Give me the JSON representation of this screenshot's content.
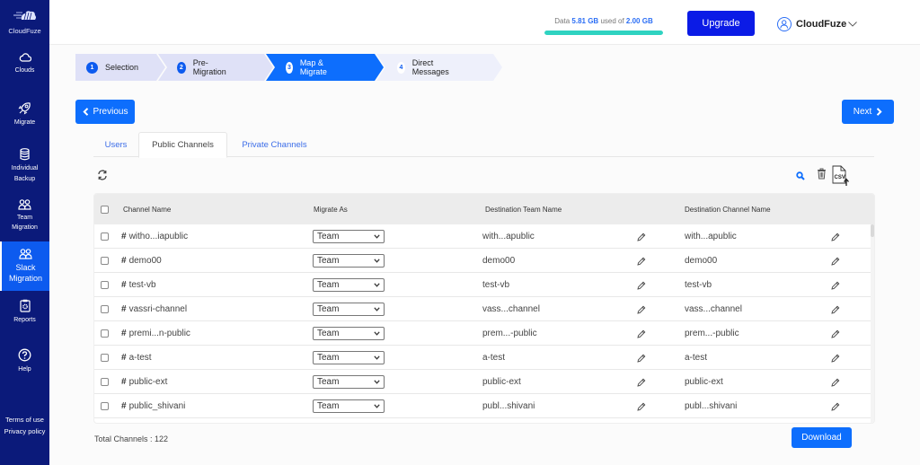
{
  "app": {
    "brand": "CloudFuze",
    "accent": "#0d6efd",
    "sidebar_bg": "#0b1a7a"
  },
  "sidebar": {
    "items": [
      {
        "label": "Clouds",
        "icon": "cloud-icon"
      },
      {
        "label": "Migrate",
        "icon": "rocket-icon"
      },
      {
        "label": "Individual Backup",
        "line1": "Individual",
        "line2": "Backup",
        "icon": "database-icon"
      },
      {
        "label": "Team Migration",
        "line1": "Team",
        "line2": "Migration",
        "icon": "users-icon"
      },
      {
        "label": "Slack Migration",
        "line1": "Slack",
        "line2": "Migration",
        "icon": "users-icon",
        "active": true
      },
      {
        "label": "Reports",
        "icon": "clipboard-gear-icon"
      },
      {
        "label": "Help",
        "icon": "help-circle-icon"
      }
    ],
    "footer": {
      "terms": "Terms of use",
      "privacy": "Privacy policy"
    }
  },
  "header": {
    "usage": {
      "prefix": "Data",
      "used": "5.81 GB",
      "middle": "used of",
      "total": "2.00 GB",
      "fill_percent": 100
    },
    "upgrade_label": "Upgrade",
    "user_name": "CloudFuze"
  },
  "stepper": {
    "steps": [
      {
        "num": "1",
        "label": "Selection",
        "state": "done"
      },
      {
        "num": "2",
        "label": "Pre-Migration",
        "state": "done"
      },
      {
        "num": "3",
        "label": "Map & Migrate",
        "state": "active"
      },
      {
        "num": "4",
        "label": "Direct Messages",
        "state": "future"
      }
    ]
  },
  "nav": {
    "previous_label": "Previous",
    "next_label": "Next"
  },
  "tabs": [
    {
      "label": "Users"
    },
    {
      "label": "Public Channels",
      "active": true
    },
    {
      "label": "Private Channels"
    }
  ],
  "table": {
    "columns": [
      "Channel Name",
      "Migrate As",
      "Destination Team Name",
      "Destination Channel Name"
    ],
    "rows": [
      {
        "channel": "witho...iapublic",
        "migrate_as": "Team",
        "dest_team": "with...apublic",
        "dest_channel": "with...apublic"
      },
      {
        "channel": "demo00",
        "migrate_as": "Team",
        "dest_team": "demo00",
        "dest_channel": "demo00"
      },
      {
        "channel": "test-vb",
        "migrate_as": "Team",
        "dest_team": "test-vb",
        "dest_channel": "test-vb"
      },
      {
        "channel": "vassri-channel",
        "migrate_as": "Team",
        "dest_team": "vass...channel",
        "dest_channel": "vass...channel"
      },
      {
        "channel": "premi...n-public",
        "migrate_as": "Team",
        "dest_team": "prem...-public",
        "dest_channel": "prem...-public"
      },
      {
        "channel": "a-test",
        "migrate_as": "Team",
        "dest_team": "a-test",
        "dest_channel": "a-test"
      },
      {
        "channel": "public-ext",
        "migrate_as": "Team",
        "dest_team": "public-ext",
        "dest_channel": "public-ext"
      },
      {
        "channel": "public_shivani",
        "migrate_as": "Team",
        "dest_team": "publ...shivani",
        "dest_channel": "publ...shivani"
      }
    ]
  },
  "footer": {
    "total_label": "Total Channels : 122",
    "download_label": "Download"
  }
}
